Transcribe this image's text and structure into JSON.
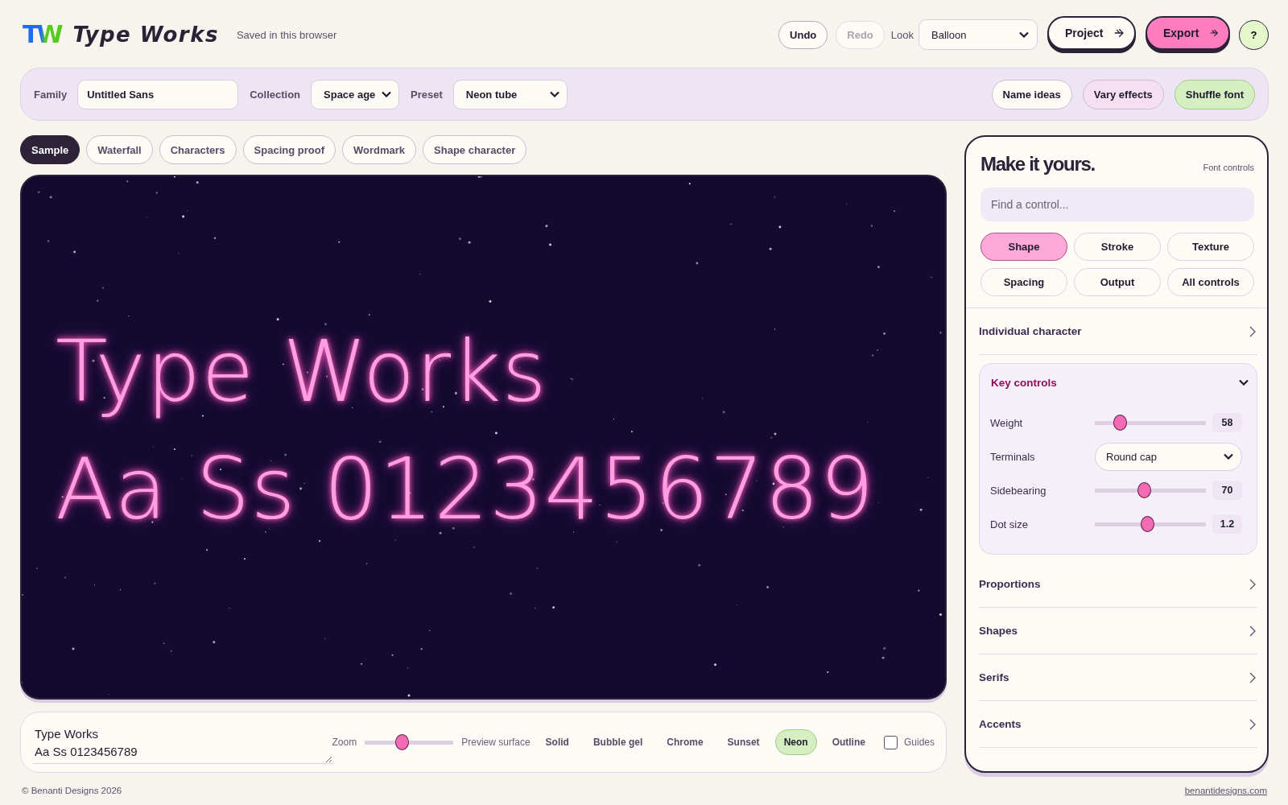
{
  "header": {
    "logo_mark": "TW",
    "app_name": "Type Works",
    "save_status": "Saved in this browser",
    "actions": [
      {
        "label": "Undo",
        "disabled": false
      },
      {
        "label": "Redo",
        "disabled": true
      }
    ],
    "look": {
      "label": "Look",
      "value": "Balloon"
    },
    "buttons": [
      {
        "kind": "outline",
        "label": "Project"
      },
      {
        "kind": "primary",
        "label": "Export"
      }
    ],
    "help": "?"
  },
  "toolbar": {
    "fields": [
      {
        "kind": "text",
        "label": "Family",
        "value": "Untitled Sans"
      },
      {
        "kind": "select",
        "label": "Collection",
        "value": "Space age"
      },
      {
        "kind": "select",
        "label": "Preset",
        "value": "Neon tube"
      }
    ],
    "buttons": [
      {
        "label": "Name ideas",
        "color": "#fdfbf6"
      },
      {
        "label": "Vary effects",
        "color": "#f6dff0"
      },
      {
        "label": "Shuffle font",
        "color": "#d6efc2"
      }
    ]
  },
  "view_tabs": [
    {
      "label": "Sample",
      "selected": true
    },
    {
      "label": "Waterfall",
      "selected": false
    },
    {
      "label": "Characters",
      "selected": false
    },
    {
      "label": "Spacing proof",
      "selected": false
    },
    {
      "label": "Wordmark",
      "selected": false
    },
    {
      "label": "Shape character",
      "selected": false
    }
  ],
  "preview": {
    "lines": [
      "Type Works",
      "Aa Ss 0123456789"
    ]
  },
  "bottom_bar": {
    "sample_text": "Type Works\nAa Ss 0123456789",
    "zoom": {
      "label": "Zoom",
      "level": 0.41
    },
    "surface_label": "Preview surface",
    "surfaces": [
      {
        "label": "Solid",
        "selected": false
      },
      {
        "label": "Bubble gel",
        "selected": false
      },
      {
        "label": "Chrome",
        "selected": false
      },
      {
        "label": "Sunset",
        "selected": false
      },
      {
        "label": "Neon",
        "selected": true
      },
      {
        "label": "Outline",
        "selected": false
      }
    ],
    "guides": {
      "label": "Guides",
      "checked": false
    }
  },
  "controls_panel": {
    "title": "Make it yours.",
    "subtitle": "Font controls",
    "search": {
      "placeholder": "Find a control..."
    },
    "categories": [
      {
        "label": "Shape",
        "selected": true
      },
      {
        "label": "Stroke",
        "selected": false
      },
      {
        "label": "Texture",
        "selected": false
      },
      {
        "label": "Spacing",
        "selected": false
      },
      {
        "label": "Output",
        "selected": false
      },
      {
        "label": "All controls",
        "selected": false
      }
    ],
    "sections": [
      {
        "title": "Individual character",
        "expanded": false
      },
      {
        "title": "Key controls",
        "expanded": true,
        "rows": [
          {
            "kind": "slider",
            "label": "Weight",
            "level": 0.19,
            "reading": "58"
          },
          {
            "kind": "select",
            "label": "Terminals",
            "value": "Round cap"
          },
          {
            "kind": "slider",
            "label": "Sidebearing",
            "level": 0.44,
            "reading": "70"
          },
          {
            "kind": "slider",
            "label": "Dot size",
            "level": 0.47,
            "reading": "1.2"
          }
        ]
      },
      {
        "title": "Proportions",
        "expanded": false
      },
      {
        "title": "Shapes",
        "expanded": false
      },
      {
        "title": "Serifs",
        "expanded": false
      },
      {
        "title": "Accents",
        "expanded": false
      }
    ]
  },
  "footer": {
    "copyright": "© Benanti Designs 2026",
    "link": "benantidesigns.com"
  }
}
